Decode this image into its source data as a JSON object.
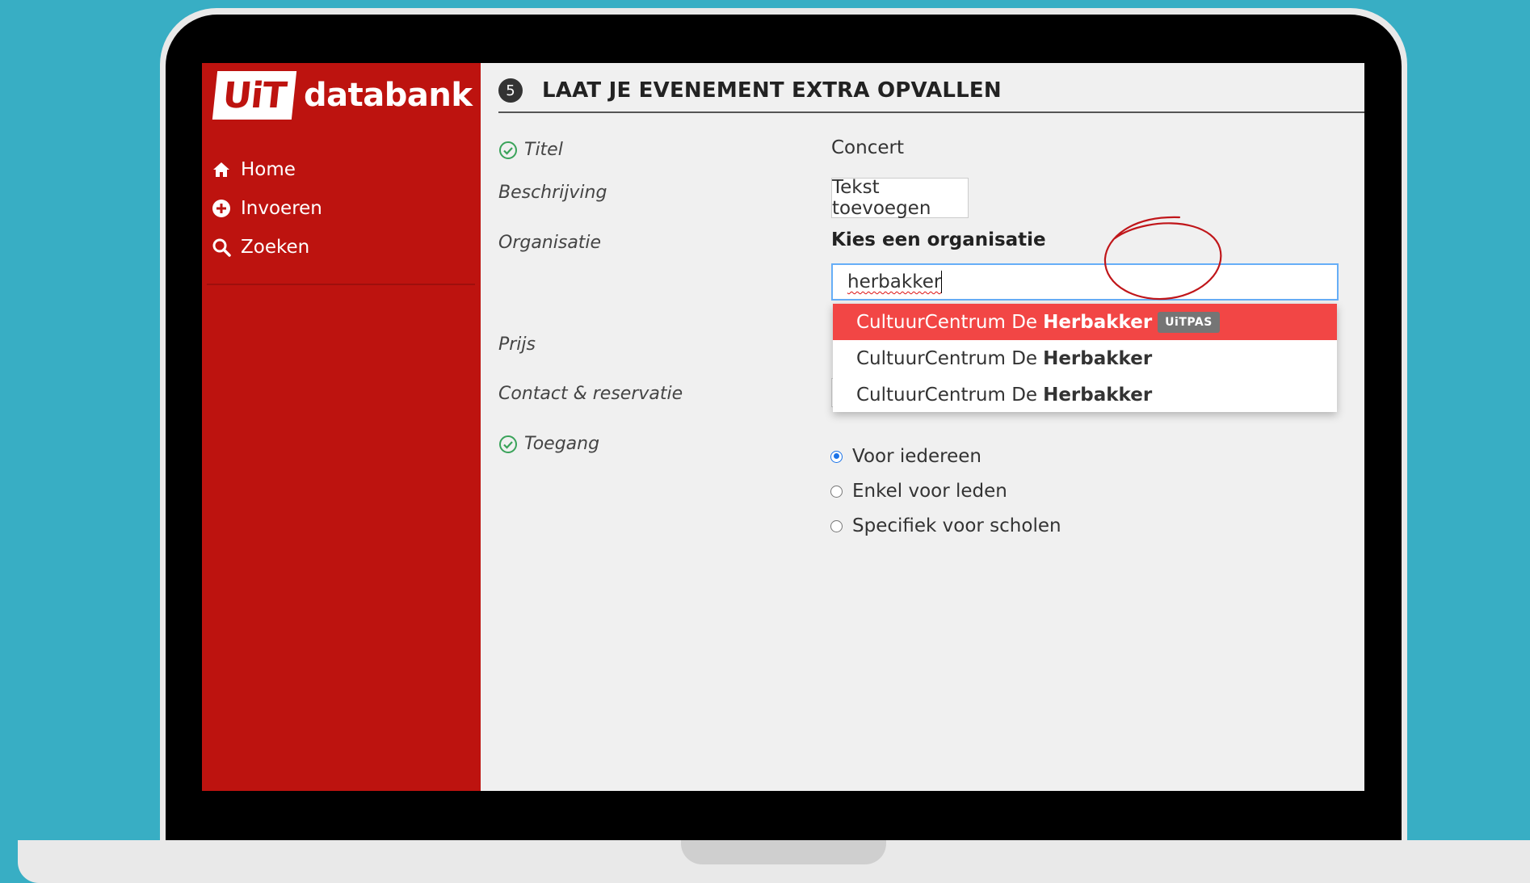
{
  "brand": {
    "logo_mark": "UiT",
    "logo_text": "databank",
    "primary_color": "#bd130f"
  },
  "sidebar": {
    "items": [
      {
        "label": "Home",
        "icon": "home-icon"
      },
      {
        "label": "Invoeren",
        "icon": "plus-circle-icon"
      },
      {
        "label": "Zoeken",
        "icon": "search-icon"
      }
    ]
  },
  "step": {
    "number": "5",
    "title": "LAAT JE EVENEMENT EXTRA OPVALLEN"
  },
  "form": {
    "labels": {
      "titel": "Titel",
      "beschrijving": "Beschrijving",
      "organisatie": "Organisatie",
      "prijs": "Prijs",
      "contact": "Contact & reservatie",
      "toegang": "Toegang"
    },
    "titel_value": "Concert",
    "add_text_button": "Tekst toevoegen",
    "org_prompt": "Kies een organisatie",
    "org_search_value": "herbakker",
    "suggestions": [
      {
        "prefix": "CultuurCentrum De",
        "match": "Herbakker",
        "badge": "UiTPAS"
      },
      {
        "prefix": "CultuurCentrum De",
        "match": "Herbakker"
      },
      {
        "prefix": "CultuurCentrum De",
        "match": "Herbakker"
      }
    ],
    "access_options": [
      "Voor iedereen",
      "Enkel voor leden",
      "Specifiek voor scholen"
    ],
    "access_selected": "Voor iedereen"
  },
  "colors": {
    "highlight": "#f24645",
    "check": "#3aa35a",
    "focus": "#66aef7"
  }
}
